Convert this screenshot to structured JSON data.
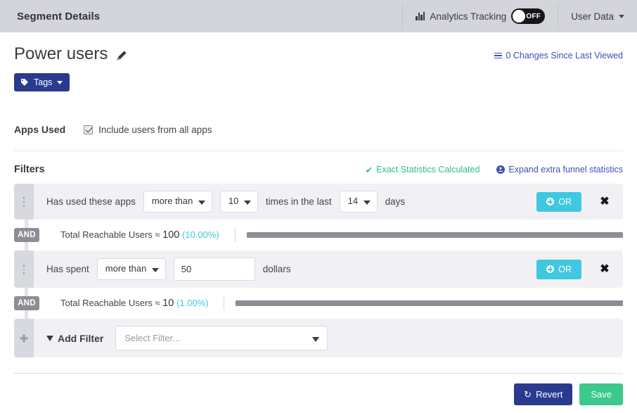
{
  "topbar": {
    "title": "Segment Details",
    "analytics": {
      "icon": "bar-chart-icon",
      "label": "Analytics Tracking",
      "toggle_state": "OFF"
    },
    "user_data": {
      "label": "User Data",
      "icon": "chevron-down-icon"
    }
  },
  "header": {
    "segment_name": "Power users",
    "edit_icon": "pencil-icon",
    "changes_link": "0 Changes Since Last Viewed",
    "changes_icon": "list-icon",
    "tags_button": "Tags",
    "tags_icon": "tag-icon"
  },
  "apps_used": {
    "label": "Apps Used",
    "checkbox_label": "Include users from all apps",
    "checked": true
  },
  "filters": {
    "title": "Filters",
    "exact_stats": "Exact Statistics Calculated",
    "exact_stats_icon": "check-icon",
    "expand_link": "Expand extra funnel statistics",
    "expand_icon": "download-circle-icon",
    "rows": [
      {
        "label": "Has used these apps",
        "operator": "more than",
        "count": "10",
        "mid_label": "times in the last",
        "days": "14",
        "suffix": "days",
        "or_button": "OR",
        "remove_icon": "close-icon"
      },
      {
        "label": "Has spent",
        "operator": "more than",
        "amount": "50",
        "suffix": "dollars",
        "or_button": "OR",
        "remove_icon": "close-icon"
      }
    ],
    "stats": [
      {
        "connector": "AND",
        "prefix": "Total Reachable Users ≈",
        "value": "100",
        "percent": "(10.00%)",
        "bar_fill_percent": 100
      },
      {
        "connector": "AND",
        "prefix": "Total Reachable Users ≈",
        "value": "10",
        "percent": "(1.00%)",
        "bar_fill_percent": 100
      }
    ],
    "add_filter": {
      "plus_icon": "plus-icon",
      "funnel_icon": "funnel-icon",
      "label": "Add Filter",
      "select_placeholder": "Select Filter..."
    }
  },
  "footer": {
    "revert_label": "Revert",
    "revert_icon": "undo-icon",
    "save_label": "Save"
  },
  "colors": {
    "topbar_bg": "#d4d5da",
    "brand_blue": "#2a3a8f",
    "link_blue": "#3f51b5",
    "cyan": "#3fc8e0",
    "green": "#3cc98c",
    "gray": "#8c8d95"
  }
}
